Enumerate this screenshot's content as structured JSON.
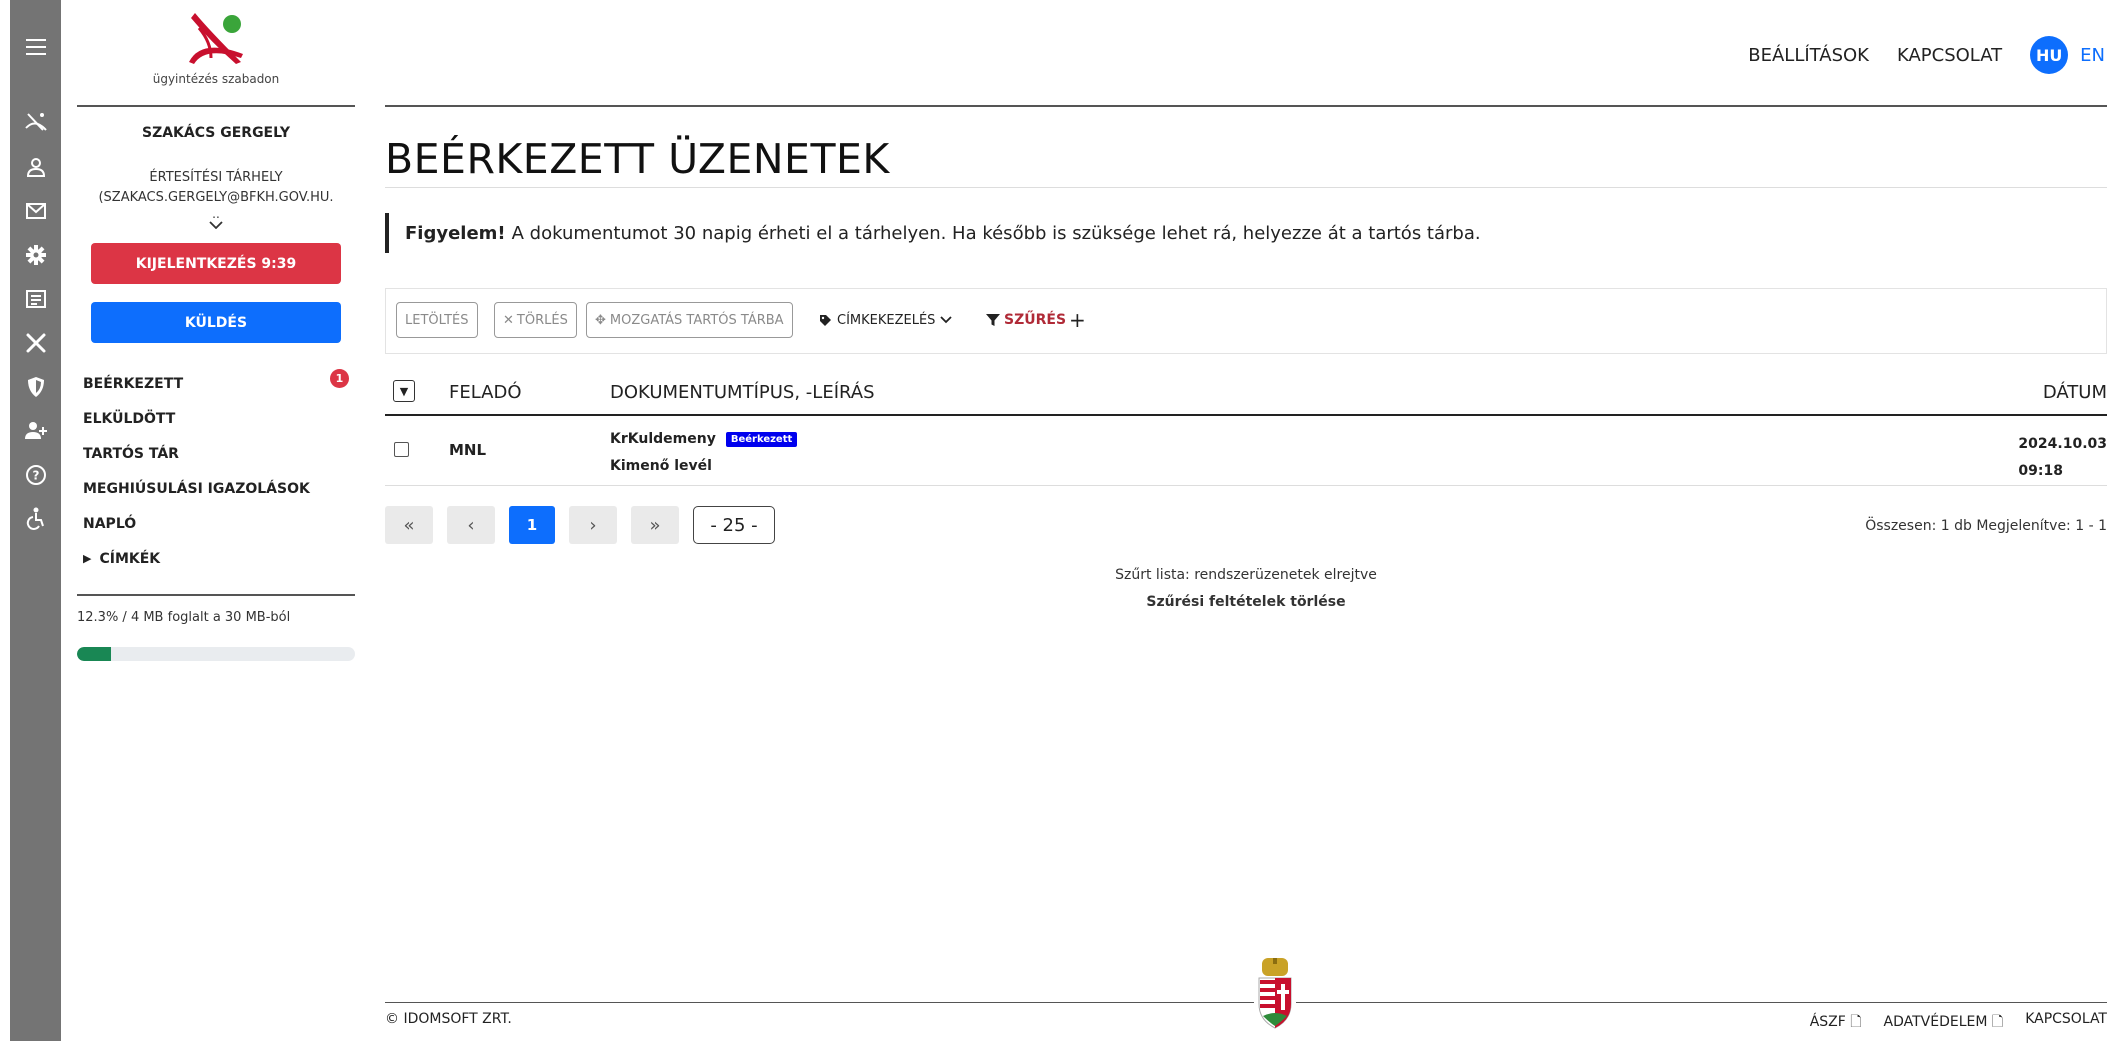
{
  "colors": {
    "danger": "#dc3545",
    "primary": "#0d6efd",
    "success": "#198754",
    "rail": "#747474",
    "status_badge": "#0000ee"
  },
  "rail_icons": [
    "menu-icon",
    "ugyfelkapu-icon",
    "user-icon",
    "mail-icon",
    "gear-icon",
    "newspaper-icon",
    "tools-icon",
    "shield-icon",
    "user-plus-icon",
    "help-icon",
    "accessibility-icon"
  ],
  "logo": {
    "tagline": "ügyintézés szabadon"
  },
  "user": {
    "name": "SZAKÁCS GERGELY",
    "storage_line1": "ÉRTESÍTÉSI TÁRHELY",
    "storage_line2": "(SZAKACS.GERGELY@BFKH.GOV.HU.",
    "more": ".."
  },
  "buttons": {
    "logout": "KIJELENTKEZÉS 9:39",
    "send": "KÜLDÉS"
  },
  "nav": {
    "inbox": "BEÉRKEZETT",
    "inbox_count": "1",
    "sent": "ELKÜLDÖTT",
    "archive": "TARTÓS TÁR",
    "failed": "MEGHIÚSULÁSI IGAZOLÁSOK",
    "log": "NAPLÓ",
    "labels": "CÍMKÉK"
  },
  "quota": {
    "text": "12.3% / 4 MB foglalt a 30 MB-ból",
    "fraction": 0.123
  },
  "topnav": {
    "settings": "BEÁLLÍTÁSOK",
    "contact": "KAPCSOLAT",
    "lang_active": "HU",
    "lang_other": "EN"
  },
  "page": {
    "title": "BEÉRKEZETT ÜZENETEK"
  },
  "alert": {
    "bold": "Figyelem!",
    "text": "A dokumentumot 30 napig érheti el a tárhelyen. Ha később is szüksége lehet rá, helyezze át a tartós tárba."
  },
  "toolbar": {
    "download": "LETÖLTÉS",
    "delete": "TÖRLÉS",
    "move": "MOZGATÁS TARTÓS TÁRBA",
    "labels": "CÍMKEKEZELÉS",
    "filter": "SZŰRÉS",
    "add": "+"
  },
  "table": {
    "headers": {
      "sender": "FELADÓ",
      "doctype": "DOKUMENTUMTÍPUS, -LEÍRÁS",
      "date": "DÁTUM"
    },
    "rows": [
      {
        "sender": "MNL",
        "doc_type": "KrKuldemeny",
        "status": "Beérkezett",
        "description": "Kimenő levél",
        "date": "2024.10.03",
        "time": "09:18"
      }
    ]
  },
  "pagination": {
    "first": "«",
    "prev": "‹",
    "page": "1",
    "next": "›",
    "last": "»",
    "per_page": "- 25 -"
  },
  "counts": "Összesen: 1 db  Megjelenítve: 1 - 1",
  "filter": {
    "note": "Szűrt lista: rendszerüzenetek elrejtve",
    "clear": "Szűrési feltételek törlése"
  },
  "footer": {
    "copyright": "© IDOMSOFT ZRT.",
    "aszf": "ÁSZF",
    "privacy": "ADATVÉDELEM",
    "contact": "KAPCSOLAT"
  }
}
